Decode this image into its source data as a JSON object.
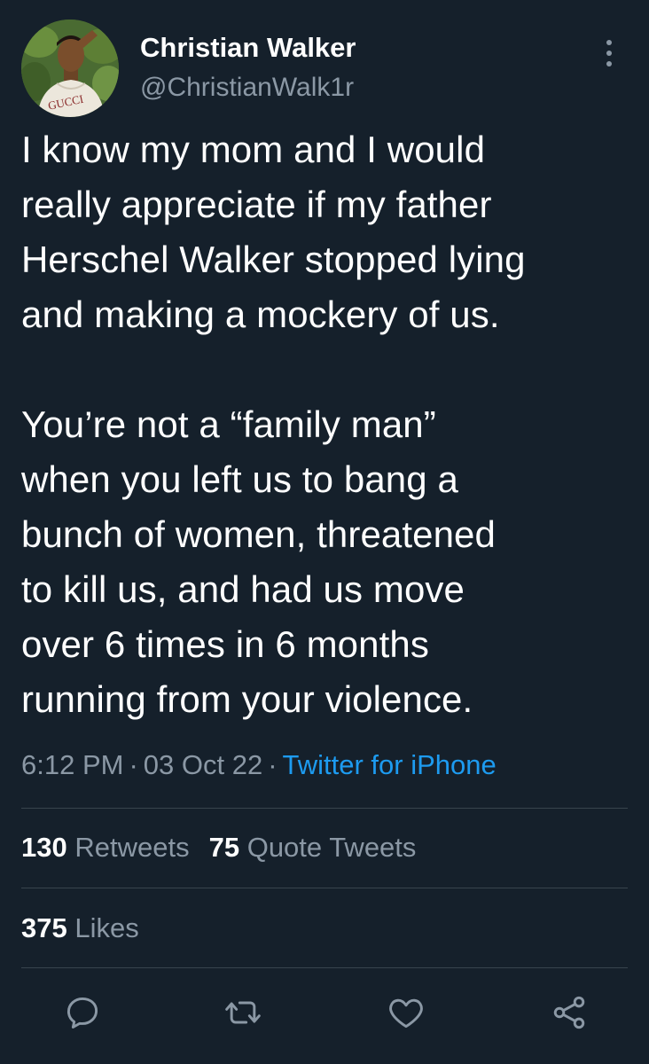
{
  "author": {
    "name": "Christian Walker",
    "handle": "@ChristianWalk1r",
    "avatar_shirt_text": "GUCCI"
  },
  "tweet": {
    "text": "I know my mom and I would\nreally appreciate if my father\nHerschel Walker stopped lying\nand making a mockery of us.\n\nYou’re not a “family man”\nwhen you left us to bang a\nbunch of women, threatened\nto kill us, and had us move\nover 6 times in 6 months\nrunning from your violence.",
    "time": "6:12 PM",
    "separator": "·",
    "date": "03 Oct 22",
    "source": "Twitter for iPhone"
  },
  "stats": {
    "retweets_count": "130",
    "retweets_label": "Retweets",
    "quotes_count": "75",
    "quotes_label": "Quote Tweets",
    "likes_count": "375",
    "likes_label": "Likes"
  },
  "actions": [
    {
      "icon": "reply-icon"
    },
    {
      "icon": "retweet-icon"
    },
    {
      "icon": "like-icon"
    },
    {
      "icon": "share-icon"
    }
  ],
  "colors": {
    "background": "#15202b",
    "text": "#ffffff",
    "secondary": "#8b98a5",
    "link": "#1d9bf0",
    "divider": "#38444d"
  }
}
